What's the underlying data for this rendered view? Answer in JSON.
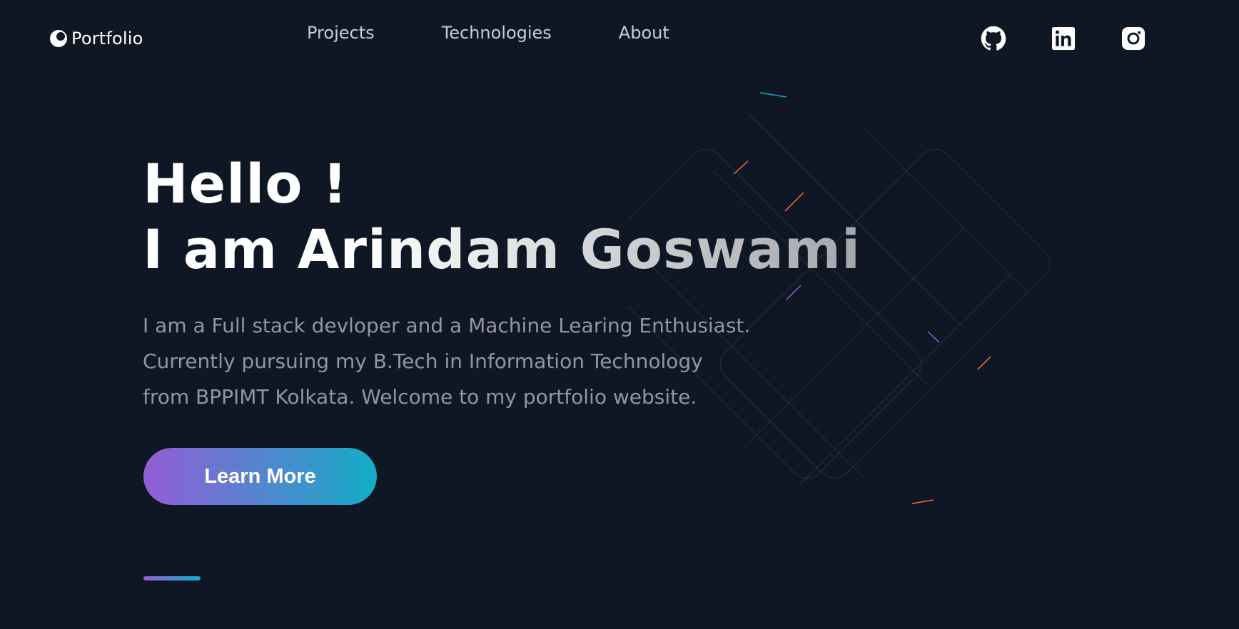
{
  "header": {
    "logo_text": "Portfolio",
    "nav": [
      {
        "label": "Projects"
      },
      {
        "label": "Technologies"
      },
      {
        "label": "About"
      }
    ],
    "social": [
      {
        "icon": "github-icon"
      },
      {
        "icon": "linkedin-icon"
      },
      {
        "icon": "instagram-icon"
      }
    ]
  },
  "hero": {
    "title_line1": "Hello !",
    "title_line2": "I am Arindam Goswami",
    "description_lines": [
      "I am a Full stack devloper and a Machine Learing Enthusiast.",
      "Currently pursuing my B.Tech in Information Technology",
      "from BPPIMT Kolkata. Welcome to my portfolio website."
    ],
    "button_label": "Learn More"
  },
  "colors": {
    "background": "#0f1624",
    "gradient_start": "#945dd6",
    "gradient_end": "#13adc7",
    "text_primary": "#ffffff"
  }
}
